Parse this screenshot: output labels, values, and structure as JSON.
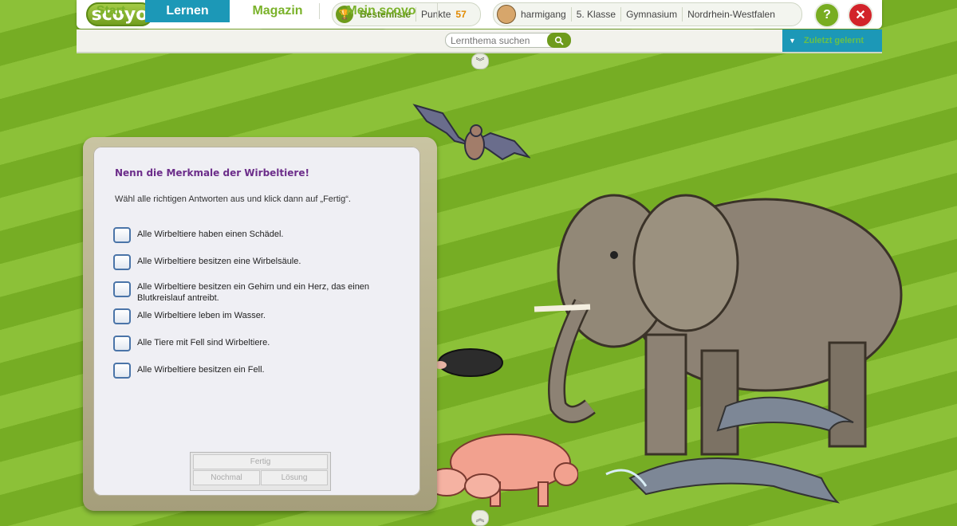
{
  "header": {
    "logo": "scoyo",
    "leaderboard_label": "Bestenliste",
    "points_label": "Punkte",
    "points_value": "57",
    "username": "harmigang",
    "grade": "5. Klasse",
    "school_type": "Gymnasium",
    "state": "Nordrhein-Westfalen",
    "help_symbol": "?",
    "close_symbol": "✕"
  },
  "nav": {
    "items": [
      {
        "label": "Start"
      },
      {
        "label": "Lernen"
      },
      {
        "label": "Magazin"
      },
      {
        "label": "Mein scoyo"
      }
    ],
    "active_index": 1,
    "search_placeholder": "Lernthema suchen",
    "dropdown_label": "Zuletzt gelernt"
  },
  "quiz": {
    "title": "Nenn die Merkmale der Wirbeltiere!",
    "instruction": "Wähl alle richtigen Antworten aus und klick dann auf „Fertig“.",
    "options": [
      {
        "label": "Alle Wirbeltiere haben einen Schädel.",
        "checked": false
      },
      {
        "label": "Alle Wirbeltiere besitzen eine Wirbelsäule.",
        "checked": false
      },
      {
        "label": "Alle Wirbeltiere besitzen ein Gehirn und ein Herz, das einen Blutkreislauf antreibt.",
        "checked": false
      },
      {
        "label": "Alle Wirbeltiere leben im Wasser.",
        "checked": false
      },
      {
        "label": "Alle Tiere mit Fell sind Wirbeltiere.",
        "checked": false
      },
      {
        "label": "Alle Wirbeltiere besitzen ein Fell.",
        "checked": false
      }
    ],
    "buttons": {
      "done": "Fertig",
      "again": "Nochmal",
      "solution": "Lösung"
    }
  },
  "colors": {
    "accent_green": "#78ad21",
    "nav_active": "#1c98b7",
    "title_purple": "#6c2d8a",
    "close_red": "#d2232a"
  },
  "icons": {
    "leaderboard": "trophy-icon",
    "search": "search-icon",
    "help": "help-icon",
    "close": "close-icon",
    "collapse": "double-chevron-down-icon",
    "expand": "double-chevron-up-icon"
  }
}
